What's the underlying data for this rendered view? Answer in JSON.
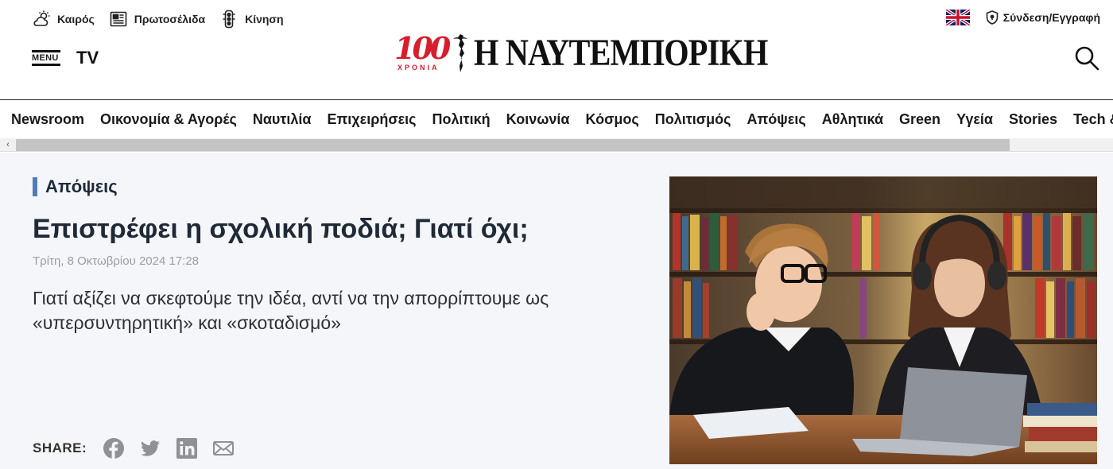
{
  "header": {
    "utilities": [
      {
        "label": "Καιρός",
        "icon": "weather-icon"
      },
      {
        "label": "Πρωτοσέλιδα",
        "icon": "newspaper-icon"
      },
      {
        "label": "Κίνηση",
        "icon": "traffic-light-icon"
      }
    ],
    "menu_label": "MENU",
    "tv_label": "TV",
    "logo": {
      "number": "100",
      "sub": "ΧΡΟΝΙΑ",
      "name": "Η ΝΑΥΤΕΜΠΟΡΙΚΗ"
    },
    "login_label": "Σύνδεση/Εγγραφή"
  },
  "nav": {
    "items": [
      "Newsroom",
      "Οικονομία & Αγορές",
      "Ναυτιλία",
      "Επιχειρήσεις",
      "Πολιτική",
      "Κοινωνία",
      "Κόσμος",
      "Πολιτισμός",
      "Απόψεις",
      "Αθλητικά",
      "Green",
      "Υγεία",
      "Stories",
      "Tech &"
    ]
  },
  "article": {
    "section": "Απόψεις",
    "title": "Επιστρέφει η σχολική ποδιά; Γιατί όχι;",
    "datetime": "Τρίτη, 8 Οκτωβρίου 2024 17:28",
    "lede": "Γιατί αξίζει να σκεφτούμε την ιδέα, αντί να την απορρίπτουμε ως «υπερσυντηρητική» και «σκοταδισμό»",
    "share_label": "SHARE:",
    "share_icons": [
      "facebook-icon",
      "twitter-icon",
      "linkedin-icon",
      "email-icon"
    ]
  },
  "colors": {
    "section_accent": "#4e7eb4",
    "logo_red": "#d81e2c",
    "main_bg": "#f5f6f9"
  }
}
